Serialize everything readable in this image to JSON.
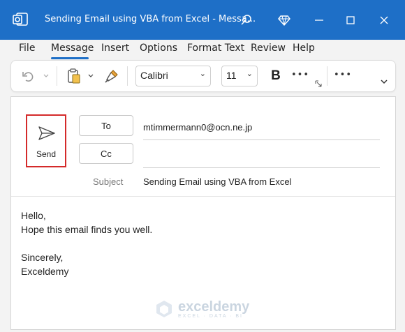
{
  "window": {
    "title": "Sending Email using VBA from Excel  -  Messa...",
    "accent": "#1e6fc7"
  },
  "menu": {
    "items": [
      "File",
      "Message",
      "Insert",
      "Options",
      "Format Text",
      "Review",
      "Help"
    ],
    "active": "Message"
  },
  "ribbon": {
    "font_name": "Calibri",
    "font_size": "11",
    "bold_label": "B",
    "more_label": "•••"
  },
  "compose": {
    "send_label": "Send",
    "to_label": "To",
    "cc_label": "Cc",
    "to_value": "mtimmermann0@ocn.ne.jp",
    "cc_value": "",
    "subject_label": "Subject",
    "subject_value": "Sending Email using VBA from Excel",
    "body_lines": [
      "Hello,",
      "Hope this email finds you well.",
      "",
      "Sincerely,",
      "Exceldemy"
    ]
  },
  "watermark": {
    "title": "exceldemy",
    "subtitle": "EXCEL · DATA · BI"
  }
}
